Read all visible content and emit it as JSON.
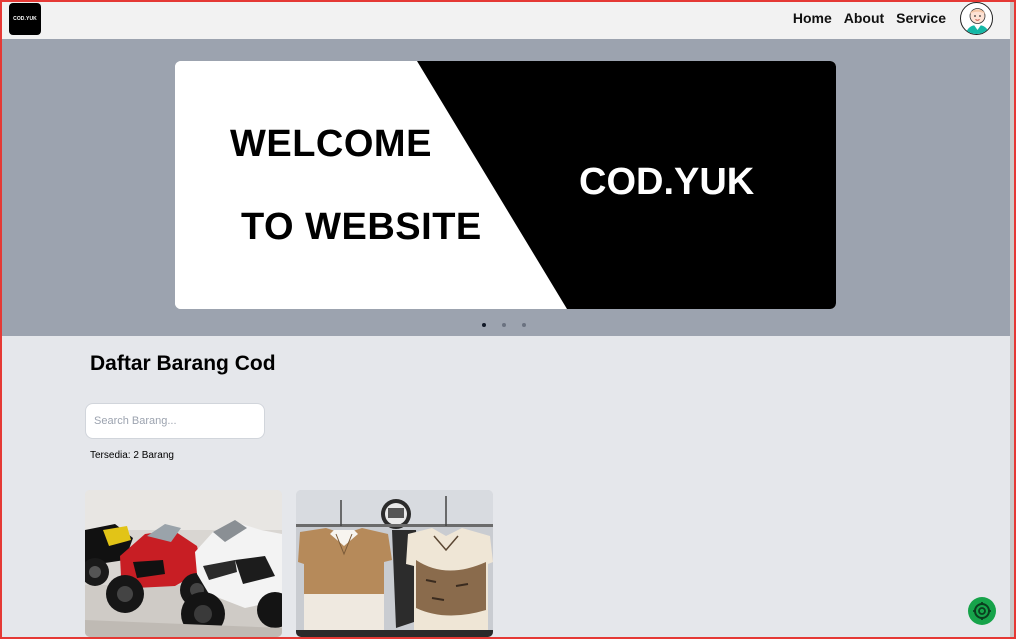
{
  "header": {
    "logo_text": "COD.YUK",
    "nav": [
      {
        "label": "Home"
      },
      {
        "label": "About"
      },
      {
        "label": "Service"
      }
    ]
  },
  "hero": {
    "welcome_line1": "WELCOME",
    "welcome_line2": "TO WEBSITE",
    "brand": "COD.YUK",
    "slides_count": 3,
    "active_slide": 1
  },
  "main": {
    "title": "Daftar Barang Cod",
    "search": {
      "placeholder": "Search Barang...",
      "value": ""
    },
    "available_text": "Tersedia: 2 Barang"
  },
  "products": [
    {
      "image": "motorcycles-photo"
    },
    {
      "image": "clothes-rack-photo"
    }
  ],
  "colors": {
    "hero_bg": "#9ca3af",
    "page_bg": "#e5e7eb",
    "fab": "#16a34a",
    "frame": "#e53935"
  }
}
